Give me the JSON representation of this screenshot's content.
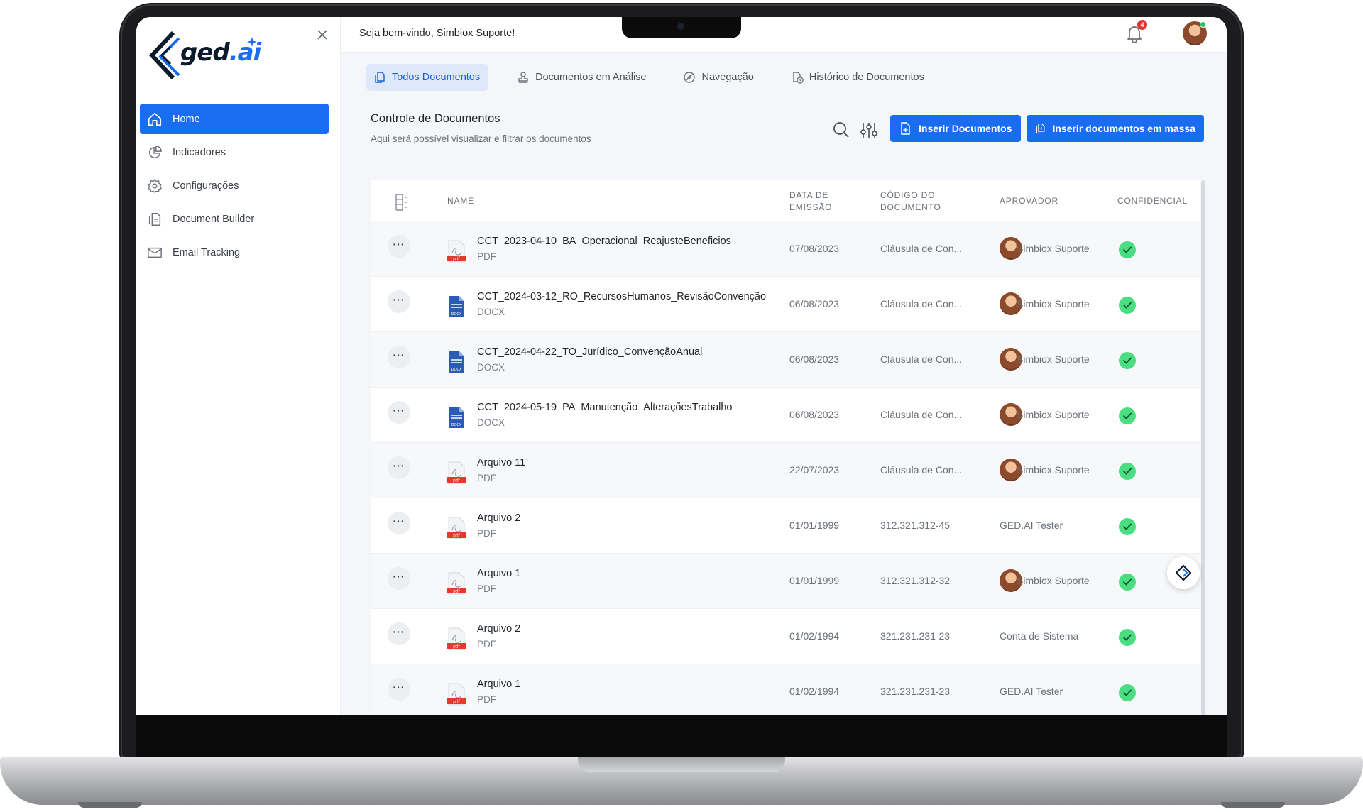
{
  "app": {
    "logo_text": "ged",
    "logo_ai": ".ai"
  },
  "sidebar": {
    "items": [
      {
        "label": "Home",
        "icon": "home-icon",
        "active": true
      },
      {
        "label": "Indicadores",
        "icon": "pie-chart-icon"
      },
      {
        "label": "Configurações",
        "icon": "gear-icon"
      },
      {
        "label": "Document Builder",
        "icon": "document-builder-icon"
      },
      {
        "label": "Email Tracking",
        "icon": "email-icon"
      }
    ]
  },
  "header": {
    "welcome": "Seja bem-vindo, Simbiox Suporte!",
    "notifications_count": "4"
  },
  "tabs": [
    {
      "label": "Todos Documentos",
      "icon": "documents-icon",
      "active": true
    },
    {
      "label": "Documentos em Análise",
      "icon": "review-stamp-icon"
    },
    {
      "label": "Navegação",
      "icon": "compass-icon"
    },
    {
      "label": "Histórico de Documentos",
      "icon": "history-icon"
    }
  ],
  "section": {
    "title": "Controle de Documentos",
    "subtitle": "Aqui será possível visualizar e filtrar os documentos",
    "insert_label": "Inserir Documentos",
    "mass_insert_label": "Inserir documentos em massa"
  },
  "table": {
    "columns": {
      "name": "NAME",
      "date_l1": "DATA DE",
      "date_l2": "EMISSÃO",
      "code_l1": "CÓDIGO DO",
      "code_l2": "DOCUMENTO",
      "approver": "APROVADOR",
      "confidential": "CONFIDENCIAL"
    },
    "rows": [
      {
        "name": "CCT_2023-04-10_BA_Operacional_ReajusteBeneficios",
        "type": "PDF",
        "date": "07/08/2023",
        "code": "Cláusula de Con...",
        "approver": "Simbiox Suporte",
        "avatar": true,
        "confidential": true
      },
      {
        "name": "CCT_2024-03-12_RO_RecursosHumanos_RevisãoConvenção",
        "type": "DOCX",
        "date": "06/08/2023",
        "code": "Cláusula de Con...",
        "approver": "Simbiox Suporte",
        "avatar": true,
        "confidential": true
      },
      {
        "name": "CCT_2024-04-22_TO_Jurídico_ConvençãoAnual",
        "type": "DOCX",
        "date": "06/08/2023",
        "code": "Cláusula de Con...",
        "approver": "Simbiox Suporte",
        "avatar": true,
        "confidential": true
      },
      {
        "name": "CCT_2024-05-19_PA_Manutenção_AlteraçõesTrabalho",
        "type": "DOCX",
        "date": "06/08/2023",
        "code": "Cláusula de Con...",
        "approver": "Simbiox Suporte",
        "avatar": true,
        "confidential": true
      },
      {
        "name": "Arquivo 11",
        "type": "PDF",
        "date": "22/07/2023",
        "code": "Cláusula de Con...",
        "approver": "Simbiox Suporte",
        "avatar": true,
        "confidential": true
      },
      {
        "name": "Arquivo 2",
        "type": "PDF",
        "date": "01/01/1999",
        "code": "312.321.312-45",
        "approver": "GED.AI Tester",
        "avatar": false,
        "confidential": true
      },
      {
        "name": "Arquivo 1",
        "type": "PDF",
        "date": "01/01/1999",
        "code": "312.321.312-32",
        "approver": "Simbiox Suporte",
        "avatar": true,
        "confidential": true
      },
      {
        "name": "Arquivo 2",
        "type": "PDF",
        "date": "01/02/1994",
        "code": "321.231.231-23",
        "approver": "Conta de Sistema",
        "avatar": false,
        "confidential": true
      },
      {
        "name": "Arquivo 1",
        "type": "PDF",
        "date": "01/02/1994",
        "code": "321.231.231-23",
        "approver": "GED.AI Tester",
        "avatar": false,
        "confidential": true
      }
    ]
  },
  "colors": {
    "primary": "#1a6cf0",
    "tab_active_bg": "#dde8fb",
    "check": "#4ade80",
    "pdf_red": "#e23b2e",
    "docx_blue": "#2b5bb5"
  }
}
